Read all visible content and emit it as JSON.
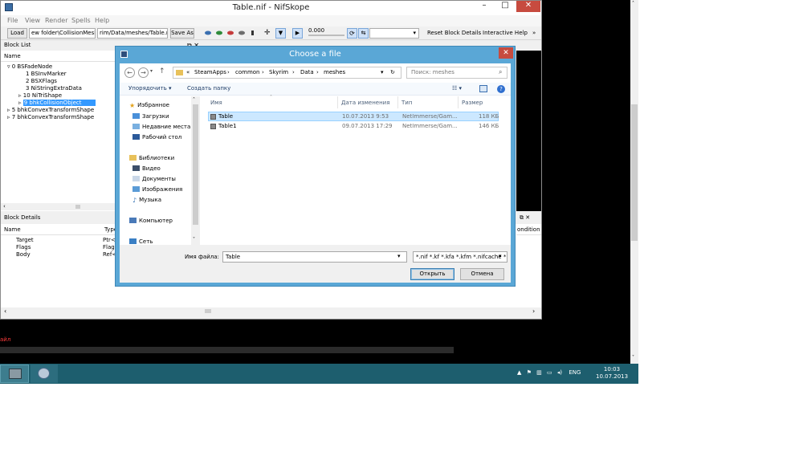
{
  "nifskope": {
    "title": "Table.nif - NifSkope",
    "win_min": "–",
    "win_max": "□",
    "win_close": "✕",
    "menu": [
      "File",
      "View",
      "Render",
      "Spells",
      "Help"
    ],
    "load_btn": "Load",
    "load_path": "ew folder\\CollisionMesh.nif",
    "save_path": "rim/Data/meshes/Table.nif",
    "save_btn": "Save As",
    "time_value": "0.000",
    "reset_btn": "Reset Block Details",
    "help_btn": "Interactive Help",
    "more": "»"
  },
  "block_list": {
    "title": "Block List",
    "col_name": "Name",
    "items": [
      "0 BSFadeNode",
      "1 BSInvMarker",
      "2 BSXFlags",
      "3 NiStringExtraData",
      "10 NiTriShape",
      "9 bhkCollisionObject",
      "5 bhkConvexTransformShape",
      "7 bhkConvexTransformShape"
    ]
  },
  "block_details": {
    "title": "Block Details",
    "col_name": "Name",
    "col_type": "Type",
    "rows": [
      {
        "name": "Target",
        "type": "Ptr<I"
      },
      {
        "name": "Flags",
        "type": "Flags"
      },
      {
        "name": "Body",
        "type": "Ref<"
      }
    ],
    "right_col": "ondition"
  },
  "bg_red_text": "айл",
  "dialog": {
    "title": "Choose a file",
    "close": "✕",
    "back": "←",
    "forward": "→",
    "up": "↑",
    "path": [
      "«",
      "SteamApps",
      "common",
      "Skyrim",
      "Data",
      "meshes"
    ],
    "search_placeholder": "Поиск: meshes",
    "organize": "Упорядочить ▾",
    "new_folder": "Создать папку",
    "nav": {
      "favorites": "Избранное",
      "downloads": "Загрузки",
      "recent": "Недавние места",
      "desktop": "Рабочий стол",
      "libraries": "Библиотеки",
      "video": "Видео",
      "documents": "Документы",
      "images": "Изображения",
      "music": "Музыка",
      "computer": "Компьютер",
      "network": "Сеть"
    },
    "columns": {
      "name": "Имя",
      "date": "Дата изменения",
      "type": "Тип",
      "size": "Размер"
    },
    "files": [
      {
        "name": "Table",
        "date": "10.07.2013 9:53",
        "type": "NetImmerse/Gam...",
        "size": "118 КБ"
      },
      {
        "name": "Table1",
        "date": "09.07.2013 17:29",
        "type": "NetImmerse/Gam...",
        "size": "146 КБ"
      }
    ],
    "filename_label": "Имя файла:",
    "filename_value": "Table",
    "filter": "*.nif *.kf *.kfa *.kfm *.nifcache *",
    "open_btn": "Открыть",
    "cancel_btn": "Отмена"
  },
  "tray": {
    "lang": "ENG",
    "time": "10:03",
    "date": "10.07.2013"
  },
  "colors": {
    "dialog_frame": "#5aa7d6",
    "taskbar": "#1d5e6e",
    "selection": "#cce8ff",
    "close": "#c74b3f"
  }
}
